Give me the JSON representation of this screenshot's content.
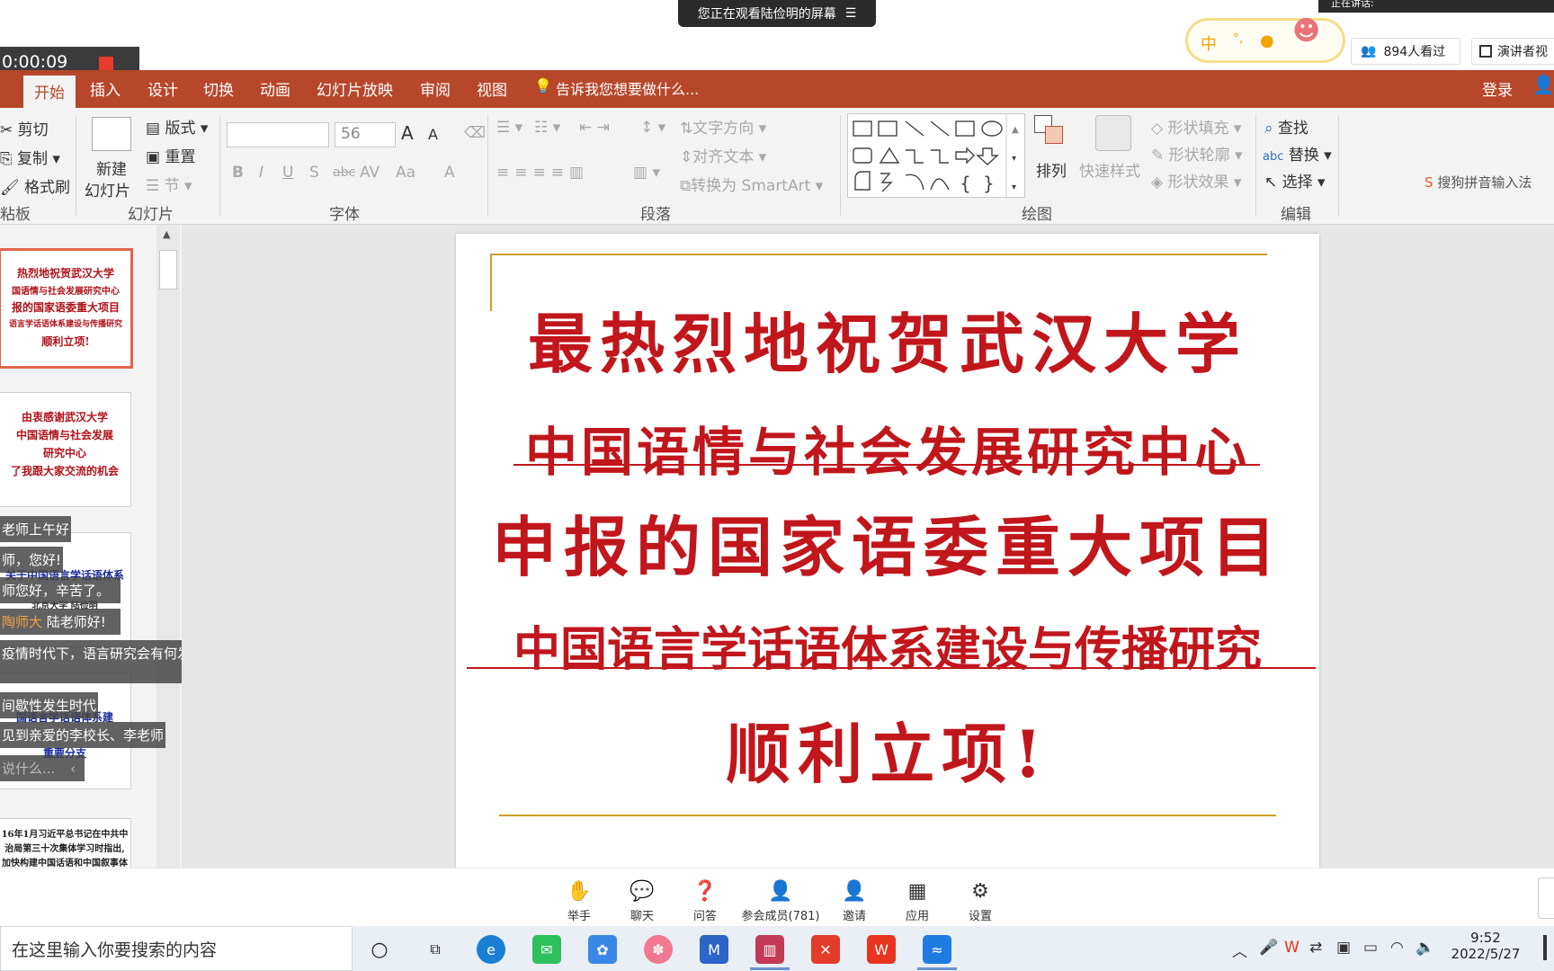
{
  "meeting": {
    "screen_banner": "您正在观看陆俭明的屏幕",
    "speaking_label": "正在讲话:",
    "viewers_count": "894人看过",
    "speaker_view_label": "演讲者视",
    "timer": "0:00:09"
  },
  "ime": {
    "lang": "中",
    "punct": "°,",
    "skin": "👕"
  },
  "ribbon": {
    "tabs": [
      "开始",
      "插入",
      "设计",
      "切换",
      "动画",
      "幻灯片放映",
      "审阅",
      "视图"
    ],
    "tell_me": "告诉我您想要做什么...",
    "login": "登录",
    "clipboard": {
      "cut": "剪切",
      "copy": "复制",
      "format_painter": "格式刷",
      "group": "粘板"
    },
    "slides": {
      "new_slide_1": "新建",
      "new_slide_2": "幻灯片",
      "layout": "版式",
      "reset": "重置",
      "section": "节",
      "group": "幻灯片"
    },
    "font": {
      "size": "56",
      "bold": "B",
      "italic": "I",
      "underline": "U",
      "shadow": "S",
      "strike": "abc",
      "spacing": "AV",
      "case": "Aa",
      "color": "A",
      "grow": "A",
      "shrink": "A",
      "group": "字体"
    },
    "paragraph": {
      "text_direction": "文字方向",
      "align_text": "对齐文本",
      "smartart": "转换为 SmartArt",
      "group": "段落"
    },
    "drawing": {
      "arrange": "排列",
      "quick_styles": "快速样式",
      "shape_fill": "形状填充",
      "shape_outline": "形状轮廓",
      "shape_effects": "形状效果",
      "group": "绘图"
    },
    "editing": {
      "find": "查找",
      "replace": "替换",
      "select": "选择",
      "group": "编辑"
    },
    "sogou": "搜狗拼音输入法"
  },
  "thumbnails": [
    {
      "lines": [
        "热烈地祝贺武汉大学",
        "国语情与社会发展研究中心",
        "报的国家语委重大项目",
        "语言学话语体系建设与传播研究",
        "顺利立项!"
      ]
    },
    {
      "lines": [
        "由衷感谢武汉大学",
        "中国语情与社会发展",
        "研究中心",
        "了我跟大家交流的机会"
      ]
    },
    {
      "lines": [
        "关于中国语言学话语体系",
        "北京大学 陆俭明"
      ]
    },
    {
      "lines": [
        "国语言学话语体系建",
        "重要分支"
      ]
    },
    {
      "lines": [
        "16年1月习近平总书记在中共中",
        "治局第三十次集体学习时指出,",
        "加快构建中国话语和中国叙事体"
      ]
    }
  ],
  "chat_messages": [
    "老师上午好",
    "师，您好!",
    "师您好，辛苦了。",
    "陆老师好!",
    "疫情时代下，语言研究会有何发",
    "间歇性发生时代",
    "见到亲爱的李校长、李老师",
    "说什么..."
  ],
  "chat_highlight": "陶师大",
  "slide": {
    "line1": "最热烈地祝贺武汉大学",
    "line2": "中国语情与社会发展研究中心",
    "line3": "申报的国家语委重大项目",
    "line4": "中国语言学话语体系建设与传播研究",
    "line5": "顺利立项!"
  },
  "meeting_bar": [
    {
      "label": "举手",
      "icon": "hand-icon",
      "glyph": "✋"
    },
    {
      "label": "聊天",
      "icon": "chat-icon",
      "glyph": "💬"
    },
    {
      "label": "问答",
      "icon": "qa-icon",
      "glyph": "❓"
    },
    {
      "label": "参会成员(781)",
      "icon": "participants-icon",
      "glyph": "👤"
    },
    {
      "label": "邀请",
      "icon": "invite-icon",
      "glyph": "👤"
    },
    {
      "label": "应用",
      "icon": "apps-icon",
      "glyph": "▦"
    },
    {
      "label": "设置",
      "icon": "settings-icon",
      "glyph": "⚙"
    }
  ],
  "taskbar": {
    "search_placeholder": "在这里输入你要搜索的内容",
    "time": "9:52",
    "date": "2022/5/27"
  },
  "colors": {
    "ribbon_accent": "#b7472a",
    "slide_red": "#c0161c",
    "gold_line": "#c9a227"
  }
}
